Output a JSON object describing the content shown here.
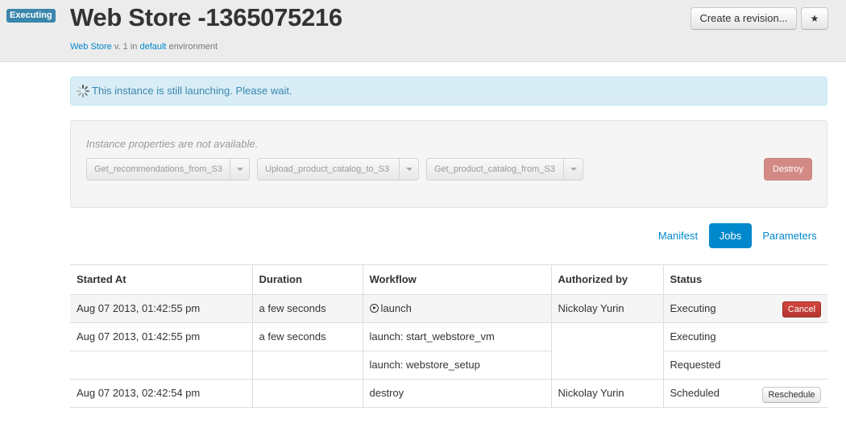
{
  "header": {
    "status_badge": "Executing",
    "title": "Web Store -1365075216",
    "subtitle": {
      "app_link": "Web Store",
      "version": "v. 1",
      "in_text": "in",
      "env_link": "default",
      "env_text": "environment"
    },
    "create_revision_label": "Create a revision...",
    "star_icon": "star-icon",
    "star_glyph": "★"
  },
  "alert": {
    "icon": "spinner-icon",
    "text": "This instance is still launching. Please wait."
  },
  "properties": {
    "note": "Instance properties are not available.",
    "actions": [
      "Get_recommendations_from_S3",
      "Upload_product_catalog_to_S3",
      "Get_product_catalog_from_S3"
    ],
    "destroy_label": "Destroy"
  },
  "tabs": [
    {
      "label": "Manifest",
      "active": false
    },
    {
      "label": "Jobs",
      "active": true
    },
    {
      "label": "Parameters",
      "active": false
    }
  ],
  "jobs": {
    "columns": [
      "Started At",
      "Duration",
      "Workflow",
      "Authorized by",
      "Status"
    ],
    "rows": [
      {
        "started": "Aug 07 2013, 01:42:55 pm",
        "duration": "a few seconds",
        "workflow": "launch",
        "authorized": "Nickolay Yurin",
        "status": "Executing",
        "action": "Cancel"
      },
      {
        "started": "Aug 07 2013, 01:42:55 pm",
        "duration": "a few seconds",
        "workflow": "launch: start_webstore_vm",
        "authorized": "",
        "status": "Executing"
      },
      {
        "started": "",
        "duration": "",
        "workflow": "launch: webstore_setup",
        "status": "Requested"
      },
      {
        "started": "Aug 07 2013, 02:42:54 pm",
        "duration": "",
        "workflow": "destroy",
        "authorized": "Nickolay Yurin",
        "status": "Scheduled",
        "action": "Reschedule"
      }
    ]
  },
  "colors": {
    "accent": "#0088cc",
    "info_bg": "#d9edf7",
    "danger": "#b33630"
  }
}
